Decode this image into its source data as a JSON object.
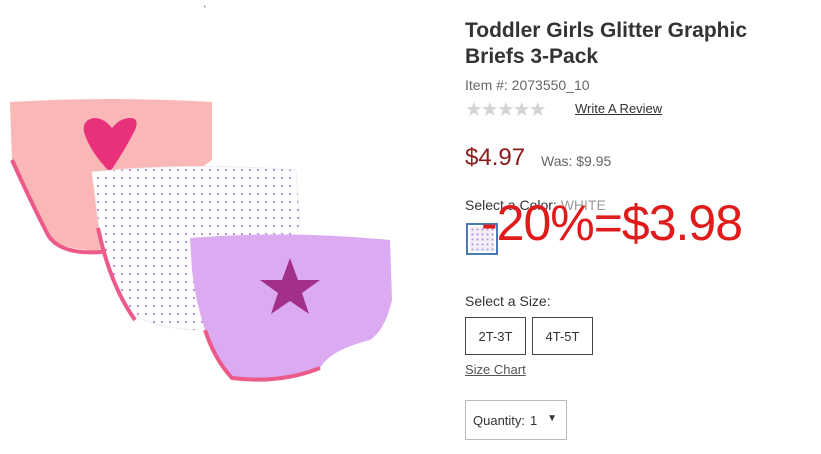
{
  "product": {
    "title": "Toddler Girls Glitter Graphic Briefs 3-Pack",
    "item_number": "Item #: 2073550_10",
    "rating_stars": "★★★★★",
    "write_review": "Write A Review",
    "price": "$4.97",
    "was_price": "Was: $9.95"
  },
  "color": {
    "label": "Select a Color: ",
    "value": "WHITE"
  },
  "promo_overlay": "-20%=$3.98",
  "size": {
    "label": "Select a Size:",
    "options": [
      "2T-3T",
      "4T-5T"
    ],
    "chart_link": "Size Chart"
  },
  "quantity": {
    "label": "Quantity:",
    "value": "1",
    "caret": "▼"
  },
  "image_top_mark": "ˎ",
  "colors": {
    "price": "#8b1a1a",
    "promo": "#e01b1b",
    "swatch_border": "#4a7ab5"
  },
  "icons": [
    "star-icon",
    "dropdown-caret-icon"
  ]
}
